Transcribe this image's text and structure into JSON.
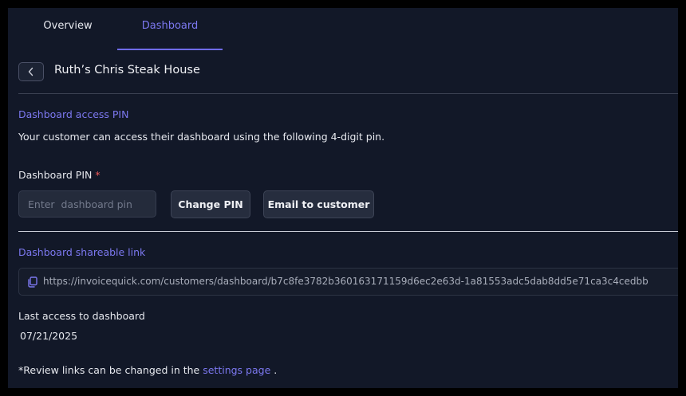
{
  "tabs": [
    {
      "label": "Overview",
      "active": false
    },
    {
      "label": "Dashboard",
      "active": true
    }
  ],
  "header": {
    "title": "Ruth’s Chris Steak House"
  },
  "access": {
    "heading": "Dashboard access PIN",
    "description": "Your customer can access their dashboard using the following 4-digit pin.",
    "pin_label": "Dashboard PIN",
    "required_mark": "*",
    "pin_value": "",
    "pin_placeholder": "Enter  dashboard pin",
    "change_pin_label": "Change PIN",
    "email_label": "Email to customer"
  },
  "share": {
    "heading": "Dashboard shareable link",
    "url": "https://invoicequick.com/customers/dashboard/b7c8fe3782b360163171159d6ec2e63d-1a81553adc5dab8dd5e71ca3c4cedbb"
  },
  "last_access": {
    "label": "Last access to dashboard",
    "date": "07/21/2025"
  },
  "footer": {
    "note_prefix": "*Review links can be changed in the",
    "link_text": "settings page",
    "note_suffix": "."
  },
  "icons": {
    "back": "chevron-left-icon",
    "copy": "copy-icon"
  },
  "colors": {
    "accent": "#7c78f0",
    "background": "#121828",
    "required": "#f05a5a"
  }
}
